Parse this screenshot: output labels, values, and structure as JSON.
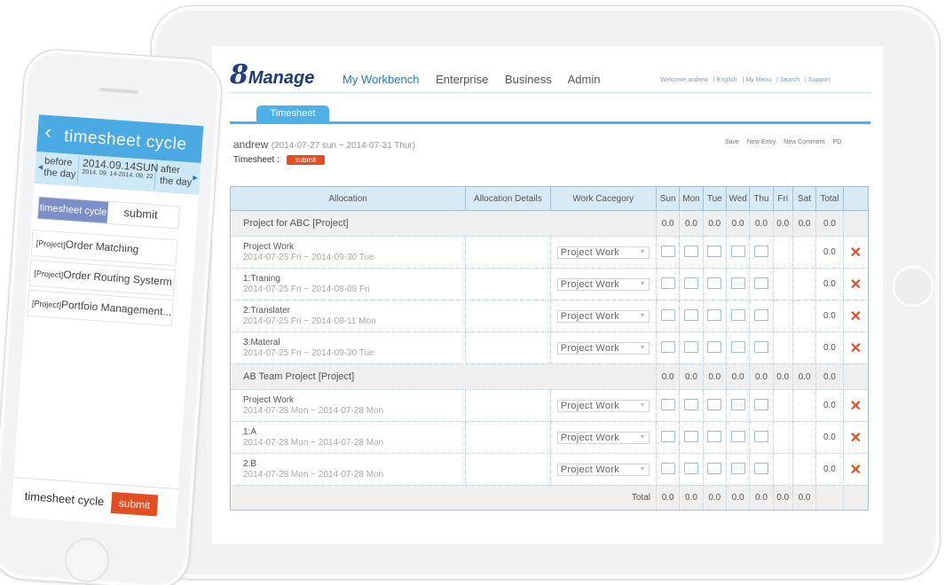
{
  "app": {
    "logo_num": "8",
    "logo_word": "Manage",
    "nav": [
      "My Workbench",
      "Enterprise",
      "Business",
      "Admin"
    ],
    "userbar": [
      "Welcome  andrew",
      "| English",
      "| My Menu",
      "| Search",
      "| Support"
    ],
    "tab": "Timesheet"
  },
  "sheet": {
    "user": "andrew",
    "range": "(2014-07-27 sun ~ 2014-07-31  Thur)",
    "label": "Timesheet :",
    "submit": "submit",
    "actions": [
      "Save",
      "New Entry",
      "New Comment",
      "PD"
    ]
  },
  "table": {
    "headers": {
      "allocation": "Allocation",
      "details": "Allocation Details",
      "category": "Work Cacegory",
      "days": [
        "Sun",
        "Mon",
        "Tue",
        "Wed",
        "Thu",
        "Fri",
        "Sat"
      ],
      "total": "Total"
    },
    "groups": [
      {
        "name": "Project for ABC [Project]",
        "sums": [
          "0.0",
          "0.0",
          "0.0",
          "0.0",
          "0.0",
          "0.0",
          "0.0",
          "0.0"
        ],
        "rows": [
          {
            "title": "Project Work",
            "dates": "2014-07-25 Fri ~ 2014-09-30 Tue",
            "category": "Project Work",
            "total": "0.0"
          },
          {
            "title": "1:Traning",
            "dates": "2014-07-25 Fri ~ 2014-08-08 Fri",
            "category": "Project Work",
            "total": "0.0"
          },
          {
            "title": "2:Translater",
            "dates": "2014-07-25 Fri ~ 2014-08-11 Mon",
            "category": "Project Work",
            "total": "0.0"
          },
          {
            "title": "3:Materal",
            "dates": "2014-07-25 Fri ~ 2014-09-30 Tue",
            "category": "Project Work",
            "total": "0.0"
          }
        ]
      },
      {
        "name": "AB Team Project [Project]",
        "sums": [
          "0.0",
          "0.0",
          "0.0",
          "0.0",
          "0.0",
          "0.0",
          "0.0",
          "0.0"
        ],
        "rows": [
          {
            "title": "Project Work",
            "dates": "2014-07-28 Mon ~ 2014-07-28 Mon",
            "category": "Project Work",
            "total": "0.0"
          },
          {
            "title": "1:A",
            "dates": "2014-07-28 Mon ~ 2014-07-28 Mon",
            "category": "Project Work",
            "total": "0.0"
          },
          {
            "title": "2:B",
            "dates": "2014-07-28 Mon ~ 2014-07-28 Mon",
            "category": "Project Work",
            "total": "0.0"
          }
        ]
      }
    ],
    "total_label": "Total",
    "totals": [
      "0.0",
      "0.0",
      "0.0",
      "0.0",
      "0.0",
      "0.0",
      "0.0"
    ]
  },
  "phone": {
    "back_glyph": "‹",
    "title": "timesheet cycle",
    "before": [
      "before",
      "the day"
    ],
    "date_big": "2014.09.14SUN",
    "date_small": "2014. 09. 14-2014. 09. 22",
    "after": [
      "after",
      "the day"
    ],
    "tab_active": "timesheet cycle",
    "tab_other": "submit",
    "items": [
      {
        "tag": "[Project]",
        "name": "Order Matching"
      },
      {
        "tag": "[Project]",
        "name": "Order Routing Systerm"
      },
      {
        "tag": "[Project]",
        "name": "Portfoio Management..."
      }
    ],
    "footer_label": "timesheet cycle",
    "footer_button": "submit"
  },
  "colors": {
    "accent": "#4db0e6",
    "brand": "#1b3b78",
    "submit": "#e24e22",
    "header_bg": "#d9eaf7"
  },
  "icons": {
    "delete": "close-x-icon",
    "back": "chevron-left-icon",
    "dropdown": "dropdown-arrow-icon"
  }
}
